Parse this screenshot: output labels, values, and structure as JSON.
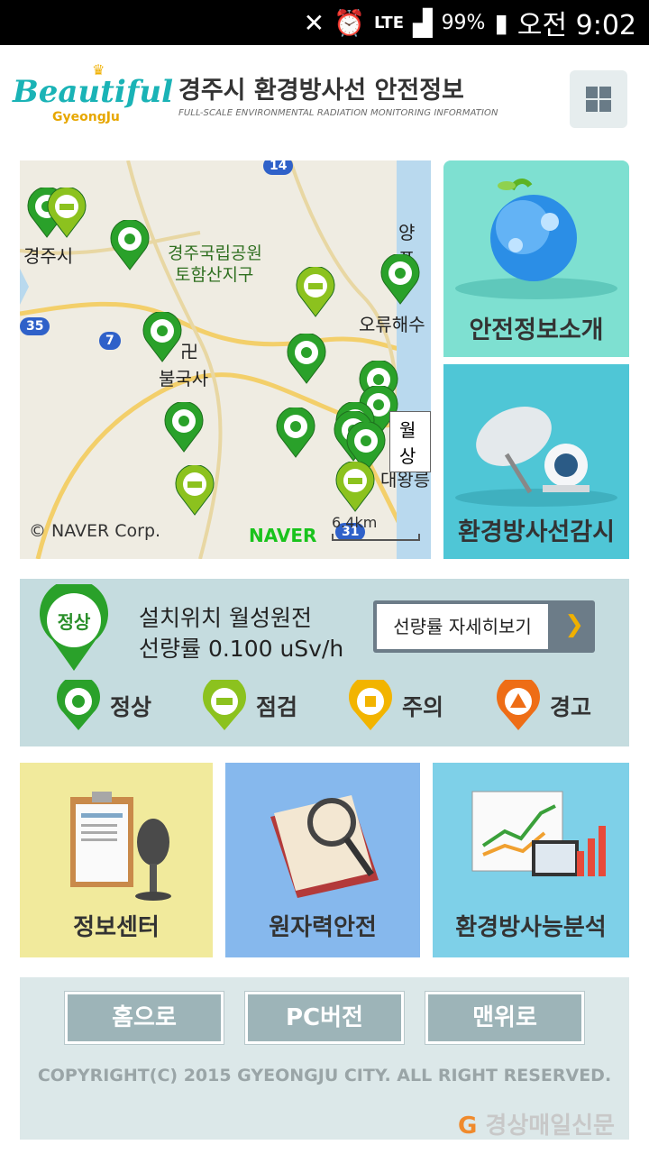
{
  "status_bar": {
    "network": "LTE",
    "battery_pct": "99%",
    "time": "오전 9:02"
  },
  "header": {
    "logo_text": "Beautiful",
    "logo_sub": "GyeongJu",
    "title": "경주시 환경방사선 안전정보",
    "subtitle": "FULL-SCALE ENVIRONMENTAL RADIATION MONITORING INFORMATION"
  },
  "map": {
    "labels": {
      "gyeongju": "경주시",
      "park": "경주국립공원",
      "park_sub": "토함산지구",
      "bulguksa": "불국사",
      "orryu": "오류해수",
      "yangpo": "양포",
      "daewang": "대왕릉",
      "ju": "주"
    },
    "road_shields": [
      "14",
      "35",
      "7",
      "31"
    ],
    "tooltip": "월상",
    "copyright": "© NAVER Corp.",
    "provider": "NAVER",
    "scale": "6.4km"
  },
  "tiles": {
    "safety_intro": "안전정보소개",
    "radiation_monitor": "환경방사선감시"
  },
  "status": {
    "badge": "정상",
    "location_line": "설치위치 월성원전",
    "dose_line": "선량률 0.100 uSv/h",
    "detail_button": "선량률 자세히보기",
    "legend": [
      {
        "label": "정상",
        "color": "#2aa12a"
      },
      {
        "label": "점검",
        "color": "#8cc21e"
      },
      {
        "label": "주의",
        "color": "#f2b400"
      },
      {
        "label": "경고",
        "color": "#ee6d16"
      }
    ]
  },
  "bottom_tiles": {
    "info_center": "정보센터",
    "nuclear_safety": "원자력안전",
    "radioactivity_analysis": "환경방사능분석"
  },
  "footer": {
    "home": "홈으로",
    "pc_version": "PC버전",
    "top": "맨위로",
    "copyright": "COPYRIGHT(C) 2015 GYEONGJU CITY. ALL RIGHT RESERVED.",
    "watermark": "경상매일신문"
  }
}
